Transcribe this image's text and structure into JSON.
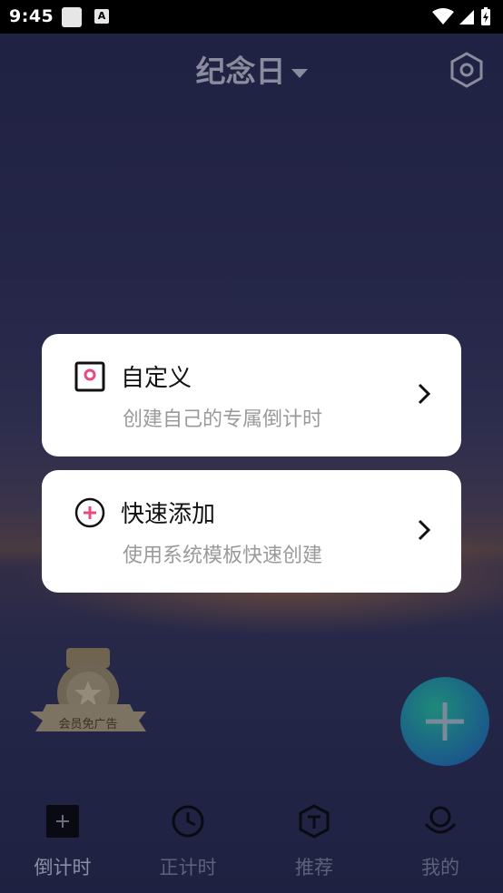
{
  "status_bar": {
    "time": "9:45",
    "notification_letter": "A"
  },
  "header": {
    "title": "纪念日"
  },
  "menu": {
    "items": [
      {
        "title": "自定义",
        "subtitle": "创建自己的专属倒计时"
      },
      {
        "title": "快速添加",
        "subtitle": "使用系统模板快速创建"
      }
    ]
  },
  "vip_badge": {
    "label": "会员免广告"
  },
  "tabs": [
    {
      "label": "倒计时",
      "icon": "plus-square-icon",
      "active": true
    },
    {
      "label": "正计时",
      "icon": "clock-icon",
      "active": false
    },
    {
      "label": "推荐",
      "icon": "hexagon-t-icon",
      "active": false
    },
    {
      "label": "我的",
      "icon": "smile-icon",
      "active": false
    }
  ],
  "colors": {
    "accent_pink": "#e84a7f",
    "fab": "#1e6b8a"
  }
}
